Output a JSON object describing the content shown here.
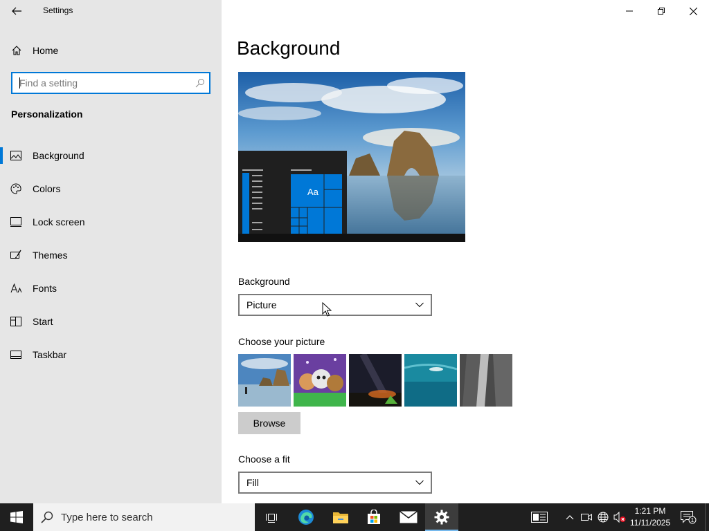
{
  "window": {
    "title": "Settings"
  },
  "nav": {
    "home_label": "Home",
    "search_placeholder": "Find a setting",
    "section_title": "Personalization",
    "items": [
      {
        "label": "Background",
        "icon": "picture-icon",
        "active": true
      },
      {
        "label": "Colors",
        "icon": "palette-icon"
      },
      {
        "label": "Lock screen",
        "icon": "lock-screen-icon"
      },
      {
        "label": "Themes",
        "icon": "themes-brush-icon"
      },
      {
        "label": "Fonts",
        "icon": "fonts-icon"
      },
      {
        "label": "Start",
        "icon": "start-icon"
      },
      {
        "label": "Taskbar",
        "icon": "taskbar-icon"
      }
    ]
  },
  "content": {
    "page_title": "Background",
    "preview": {
      "sample_text": "Aa"
    },
    "background_label": "Background",
    "background_value": "Picture",
    "choose_picture_label": "Choose your picture",
    "browse_label": "Browse",
    "choose_fit_label": "Choose a fit",
    "fit_value": "Fill"
  },
  "taskbar": {
    "search_placeholder": "Type here to search",
    "time": "1:21 PM",
    "date": "11/11/2025",
    "notification_count": "1",
    "pinned": [
      "task-view-icon",
      "edge-icon",
      "file-explorer-icon",
      "store-icon",
      "mail-icon",
      "settings-icon"
    ]
  },
  "colors": {
    "accent": "#0078d7",
    "nav_background": "#e6e6e6",
    "taskbar": "#1f1f1f"
  }
}
